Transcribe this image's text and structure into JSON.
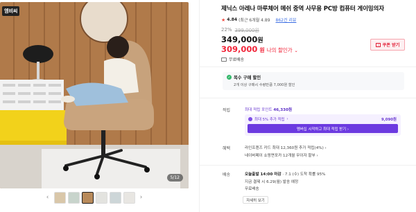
{
  "gallery": {
    "brand_badge": "엠비씨",
    "counter": "5/12",
    "prev_arrow": "‹",
    "next_arrow": "›",
    "thumb_count": 6,
    "active_thumb": 3
  },
  "product": {
    "title": "제닉스 아레나 마루체어 메쉬 중역 사무용 PC방 컴퓨터 게이밍의자",
    "rating_star": "★",
    "rating_score": "4.84",
    "rating_sub": "(최근 6개월 4.89",
    "review_link": "862건 리뷰",
    "discount_pct": "22%",
    "original_price": "399,000원",
    "price": "349,000",
    "price_unit": "원",
    "sale_price": "309,000",
    "sale_unit": "원",
    "sale_label": "나의 할인가",
    "sale_chevron": "⌄",
    "coupon_label": "쿠폰 받기",
    "shipping": "무료배송"
  },
  "multi_purchase": {
    "title": "복수 구매 할인",
    "check_icon": "✓",
    "description": "2개 이상 구매시 수량만큼 7,000원 할인"
  },
  "points": {
    "label": "적립",
    "max_text": "최대 적립 포인트",
    "max_value": "46,330원",
    "extra_label": "최대 5% 추가 적립",
    "extra_chevron": "›",
    "extra_amount": "9,090원",
    "start_button": "멤버십 시작하고 최대 적립 받기 ›"
  },
  "benefits": {
    "label": "혜택",
    "line1": "라인프렌즈 카드 최대 12,360원 추가 적립(4%) ›",
    "line2": "네이버페이 쇼핑면포카 12개월 무이자 할부 ›"
  },
  "delivery": {
    "label": "배송",
    "line1_bold": "오늘출발 14:00 마감",
    "line1_rest": " · 7.1 (수) 도착 확률 95%",
    "line2": "지금 결제 시 6.29(월) 발송 예정",
    "line3": "무료배송",
    "detail_button": "자세히 보기"
  },
  "colors": {
    "accent_red": "#f1263a",
    "accent_purple": "#6c3ae0",
    "review_blue": "#3e6fe3",
    "green_badge": "#35b86b"
  }
}
